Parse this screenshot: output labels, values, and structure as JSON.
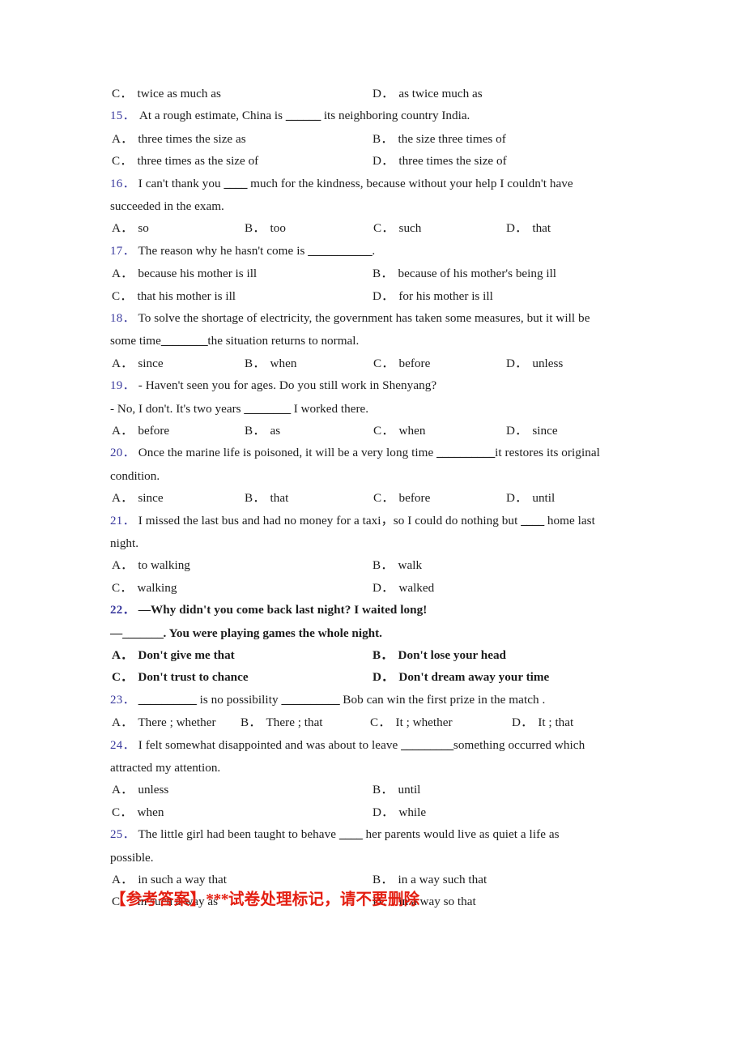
{
  "document": {
    "type": "grammar-exercise-worksheet",
    "page_background": "#ffffff",
    "question_number_color": "#3b3b9e",
    "body_text_color": "#1c1c1c",
    "answer_key_color": "#e41f12"
  },
  "orphan_options": {
    "c": {
      "label": "C",
      "sep": "．",
      "text": "twice as much as"
    },
    "d": {
      "label": "D",
      "sep": "．",
      "text": "as twice much as"
    }
  },
  "questions": [
    {
      "number": "15．",
      "stem": "At a rough estimate, China is ______ its neighboring country India.",
      "stem_pre": "At a rough estimate, China is ",
      "blank": "______",
      "stem_post": " its neighboring country India.",
      "layout": "two-column",
      "options": [
        {
          "label": "A",
          "sep": "．",
          "text": "three times the size as"
        },
        {
          "label": "B",
          "sep": "．",
          "text": "the size three times of"
        },
        {
          "label": "C",
          "sep": "．",
          "text": "three times as the size of"
        },
        {
          "label": "D",
          "sep": "．",
          "text": "three times the size of"
        }
      ]
    },
    {
      "number": "16．",
      "stem_pre": "I can't thank you ",
      "blank": "____",
      "stem_post": " much for the kindness, because without your help I couldn't have succeeded in the exam.",
      "line2": "succeeded in the exam.",
      "layout": "four-column",
      "options": [
        {
          "label": "A",
          "sep": "．",
          "text": "so"
        },
        {
          "label": "B",
          "sep": "．",
          "text": "too"
        },
        {
          "label": "C",
          "sep": "．",
          "text": "such"
        },
        {
          "label": "D",
          "sep": "．",
          "text": "that"
        }
      ]
    },
    {
      "number": "17．",
      "stem_pre": "The reason why he hasn't come is ",
      "blank": "___________",
      "stem_post": ".",
      "layout": "two-column",
      "options": [
        {
          "label": "A",
          "sep": "．",
          "text": "because his mother is ill"
        },
        {
          "label": "B",
          "sep": "．",
          "text": "because of his mother's being ill"
        },
        {
          "label": "C",
          "sep": "．",
          "text": "that his mother is ill"
        },
        {
          "label": "D",
          "sep": "．",
          "text": "for his mother is ill"
        }
      ]
    },
    {
      "number": "18．",
      "stem_pre": "To solve the shortage of electricity, the government has taken some measures, but it will be some time",
      "blank": "________",
      "stem_post": "the situation returns to normal.",
      "layout": "four-column",
      "options": [
        {
          "label": "A",
          "sep": "．",
          "text": "since"
        },
        {
          "label": "B",
          "sep": "．",
          "text": "when"
        },
        {
          "label": "C",
          "sep": "．",
          "text": "before"
        },
        {
          "label": "D",
          "sep": "．",
          "text": "unless"
        }
      ]
    },
    {
      "number": "19．",
      "stem_pre": "- Haven't seen you for ages. Do you still work in Shenyang?",
      "line2_pre": "- No, I don't. It's two years ",
      "blank": "________",
      "line2_post": " I worked there.",
      "layout": "four-column",
      "options": [
        {
          "label": "A",
          "sep": "．",
          "text": "before"
        },
        {
          "label": "B",
          "sep": "．",
          "text": "as"
        },
        {
          "label": "C",
          "sep": "．",
          "text": "when"
        },
        {
          "label": "D",
          "sep": "．",
          "text": "since"
        }
      ]
    },
    {
      "number": "20．",
      "stem_pre": "Once the marine life is poisoned, it will be a very long time ",
      "blank": "__________",
      "stem_post": "it restores its original condition.",
      "line2": "condition.",
      "layout": "four-column",
      "options": [
        {
          "label": "A",
          "sep": "．",
          "text": "since"
        },
        {
          "label": "B",
          "sep": "．",
          "text": "that"
        },
        {
          "label": "C",
          "sep": "．",
          "text": "before"
        },
        {
          "label": "D",
          "sep": "．",
          "text": "until"
        }
      ]
    },
    {
      "number": "21．",
      "stem_pre": "I missed the last bus and had no money for a taxi，so I could do nothing but ",
      "blank": "____",
      "stem_post": " home last night.",
      "line2": "night.",
      "layout": "two-column",
      "options": [
        {
          "label": "A",
          "sep": "．",
          "text": "to walking"
        },
        {
          "label": "B",
          "sep": "．",
          "text": "walk"
        },
        {
          "label": "C",
          "sep": "．",
          "text": "walking"
        },
        {
          "label": "D",
          "sep": "．",
          "text": "walked"
        }
      ]
    },
    {
      "number": "22．",
      "stem_pre": "—Why didn't you come back last night? I waited long!",
      "line2_pre": "—",
      "blank": "_______",
      "line2_post": ". You were playing games the whole night.",
      "layout": "two-column",
      "options": [
        {
          "label": "A",
          "sep": "．",
          "text": "Don't give me that"
        },
        {
          "label": "B",
          "sep": "．",
          "text": "Don't lose your head"
        },
        {
          "label": "C",
          "sep": "．",
          "text": "Don't trust to chance"
        },
        {
          "label": "D",
          "sep": "．",
          "text": "Don't dream away your time"
        }
      ]
    },
    {
      "number": "23．",
      "stem_pre": " ",
      "blank": "__________",
      "stem_mid": " is no possibility ",
      "blank2": "__________",
      "stem_post": " Bob can win the first prize in the match .",
      "layout": "four-column-b",
      "options": [
        {
          "label": "A",
          "sep": "．",
          "text": "There ; whether"
        },
        {
          "label": "B",
          "sep": "．",
          "text": "There ; that"
        },
        {
          "label": "C",
          "sep": "．",
          "text": "It ; whether"
        },
        {
          "label": "D",
          "sep": "．",
          "text": "It ; that"
        }
      ]
    },
    {
      "number": "24．",
      "stem_pre": "I felt somewhat disappointed and was about to leave ",
      "blank": "_________",
      "stem_post": "something occurred which attracted my attention.",
      "line2": "attracted my attention.",
      "layout": "two-column",
      "options": [
        {
          "label": "A",
          "sep": "．",
          "text": "unless"
        },
        {
          "label": "B",
          "sep": "．",
          "text": "until"
        },
        {
          "label": "C",
          "sep": "．",
          "text": "when"
        },
        {
          "label": "D",
          "sep": "．",
          "text": "while"
        }
      ]
    },
    {
      "number": "25．",
      "stem_pre": "The little girl had been taught to behave ",
      "blank": "____",
      "stem_post": " her parents would live as quiet a life as possible.",
      "line2": "possible.",
      "layout": "two-column",
      "options": [
        {
          "label": "A",
          "sep": "．",
          "text": "in such a way that"
        },
        {
          "label": "B",
          "sep": "．",
          "text": "in a way such that"
        },
        {
          "label": "C",
          "sep": "．",
          "text": "in such a way as"
        },
        {
          "label": "D",
          "sep": "．",
          "text": "in a way so that"
        }
      ]
    }
  ],
  "answer_key": {
    "bracket_open": "【参考答案】",
    "stars": "***",
    "note": "试卷处理标记，请不要删除",
    "full": "【参考答案】***试卷处理标记，请不要删除"
  }
}
